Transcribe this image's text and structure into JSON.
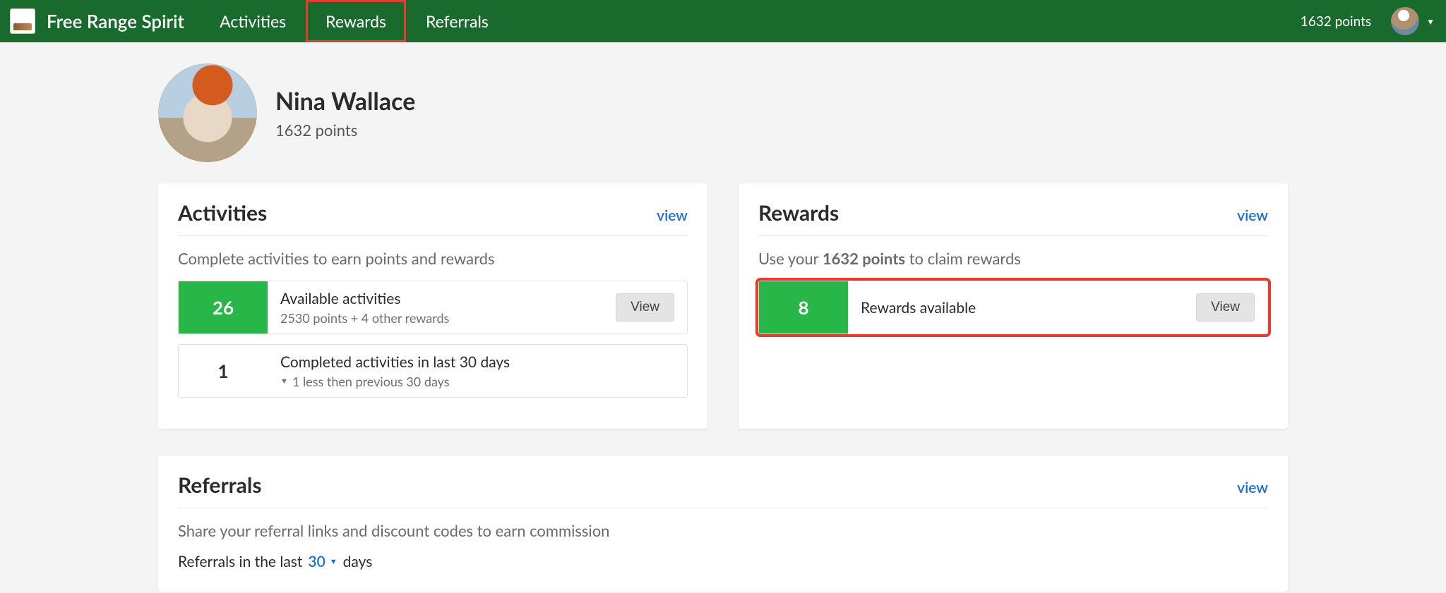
{
  "brand": {
    "name": "Free Range Spirit"
  },
  "nav": {
    "tabs": [
      {
        "label": "Activities",
        "highlight": false
      },
      {
        "label": "Rewards",
        "highlight": true
      },
      {
        "label": "Referrals",
        "highlight": false
      }
    ],
    "points_text": "1632 points"
  },
  "profile": {
    "name": "Nina Wallace",
    "points_text": "1632 points"
  },
  "activities_card": {
    "title": "Activities",
    "view_label": "view",
    "subtitle": "Complete activities to earn points and rewards",
    "available": {
      "count": "26",
      "title": "Available activities",
      "subtitle": "2530 points + 4 other rewards",
      "button": "View"
    },
    "completed": {
      "count": "1",
      "title": "Completed activities in last 30 days",
      "delta": "1 less then previous 30 days"
    }
  },
  "rewards_card": {
    "title": "Rewards",
    "view_label": "view",
    "subtitle_pre": "Use your ",
    "subtitle_points": "1632 points",
    "subtitle_post": " to claim rewards",
    "row": {
      "count": "8",
      "title": "Rewards available",
      "button": "View"
    }
  },
  "referrals_card": {
    "title": "Referrals",
    "view_label": "view",
    "subtitle": "Share your referral links and discount codes to earn commission",
    "range_pre": "Referrals in the last",
    "range_value": "30",
    "range_post": "days"
  }
}
